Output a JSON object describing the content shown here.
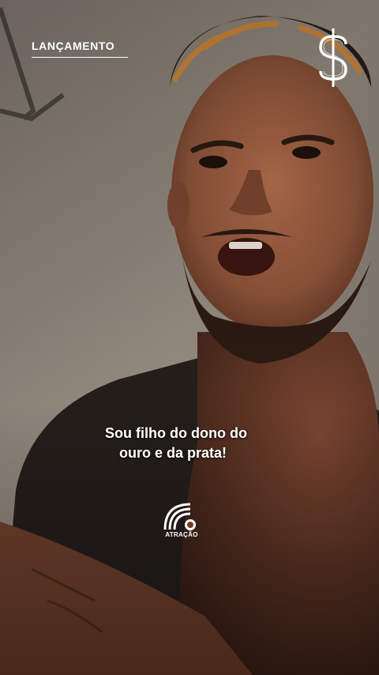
{
  "post": {
    "tag": "LANÇAMENTO",
    "subtitle_line1": "Sou filho do dono do",
    "subtitle_line2": "ouro e da prata!"
  },
  "brand": {
    "name": "ATRAÇÃO",
    "icon": "rainbow-logo-icon"
  },
  "corner_icon": "dollar-sign-icon",
  "colors": {
    "text": "#ffffff",
    "wall": "#8a7f73",
    "skin": "#8a5238",
    "hair": "#c9853a"
  }
}
